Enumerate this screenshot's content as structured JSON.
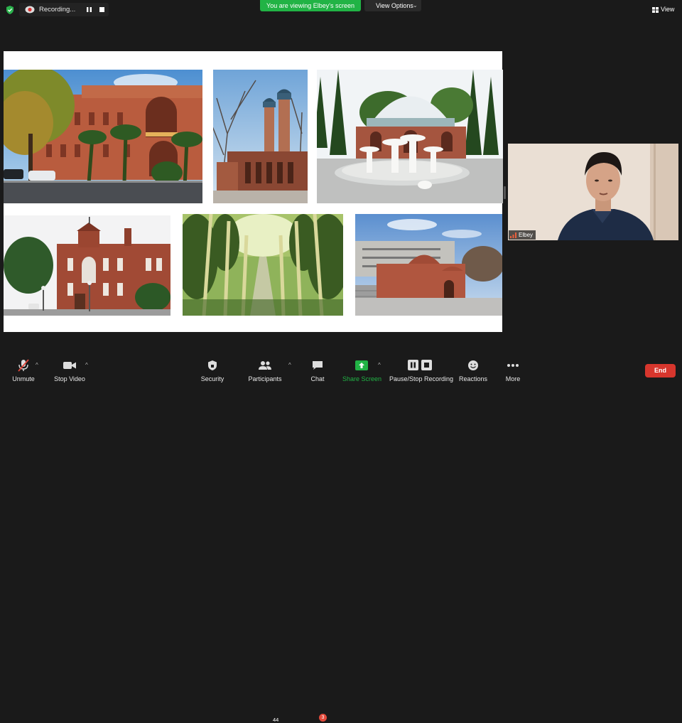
{
  "top_bar": {
    "recording_label": "Recording...",
    "viewing_banner": "You are viewing Elbey's screen",
    "view_options_label": "View Options",
    "view_label": "View"
  },
  "participant": {
    "name": "Elbey"
  },
  "toolbar": {
    "unmute": "Unmute",
    "stop_video": "Stop Video",
    "security": "Security",
    "participants": "Participants",
    "participants_count": "44",
    "chat": "Chat",
    "chat_unread": "3",
    "share_screen": "Share Screen",
    "pause_stop_recording": "Pause/Stop Recording",
    "reactions": "Reactions",
    "more": "More",
    "end": "End"
  },
  "colors": {
    "background": "#1a1a1a",
    "share_banner": "#21b345",
    "end_button": "#d7362d",
    "share_screen_icon": "#21b345",
    "chat_badge": "#e24a3b"
  },
  "icons": [
    "shield-icon",
    "recording-icon",
    "pause-icon",
    "stop-icon",
    "grid-view-icon",
    "microphone-muted-icon",
    "video-camera-icon",
    "security-shield-icon",
    "participants-icon",
    "chat-icon",
    "share-screen-arrow-icon",
    "recording-controls-icon",
    "reactions-emoji-icon",
    "more-dots-icon",
    "signal-bars-icon"
  ]
}
